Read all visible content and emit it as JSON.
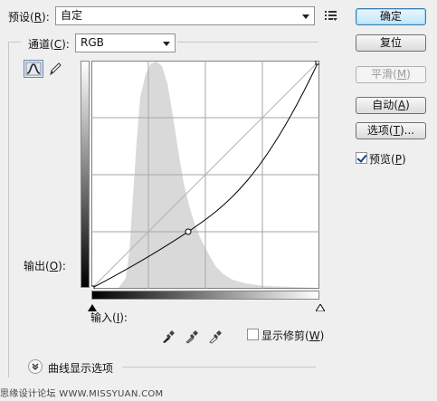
{
  "preset": {
    "label": "预设(R):",
    "label_pre": "预设(",
    "label_key": "R",
    "label_post": "):",
    "value": "自定"
  },
  "channel": {
    "label_pre": "通道(",
    "label_key": "C",
    "label_post": "):",
    "value": "RGB"
  },
  "buttons": {
    "ok": {
      "pre": "确定",
      "key": "",
      "post": ""
    },
    "reset": {
      "pre": "复位",
      "key": "",
      "post": ""
    },
    "smooth": {
      "pre": "平滑(",
      "key": "M",
      "post": ")"
    },
    "auto": {
      "pre": "自动(",
      "key": "A",
      "post": ")"
    },
    "options": {
      "pre": "选项(",
      "key": "T",
      "post": ")..."
    }
  },
  "preview": {
    "pre": "预览(",
    "key": "P",
    "post": ")",
    "checked": true
  },
  "output": {
    "pre": "输出(",
    "key": "O",
    "post": "):"
  },
  "input": {
    "pre": "输入(",
    "key": "I",
    "post": "):"
  },
  "clipping": {
    "pre": "显示修剪(",
    "key": "W",
    "post": ")",
    "checked": false
  },
  "curve_display": {
    "label": "曲线显示选项"
  },
  "watermark": "思缘设计论坛 WWW.MISSYUAN.COM",
  "colors": {
    "default_button_border": "#3c7fb1",
    "histogram": "#d9d9d9",
    "curve": "#000000"
  },
  "icons": [
    "preset-options-icon",
    "curve-tool-icon",
    "pencil-tool-icon",
    "black-eyedropper-icon",
    "gray-eyedropper-icon",
    "white-eyedropper-icon",
    "expand-chevron-icon"
  ]
}
